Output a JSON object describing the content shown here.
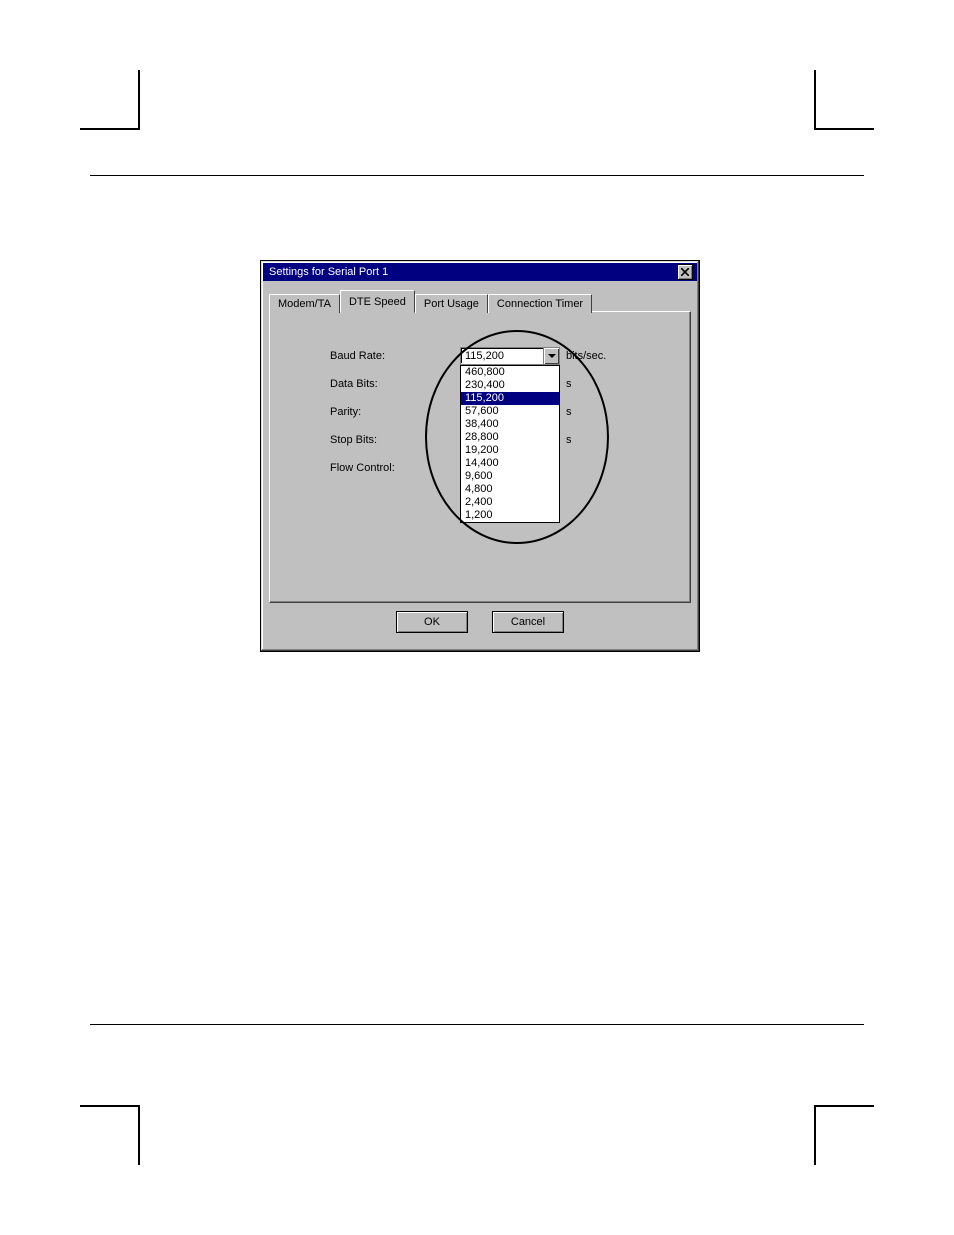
{
  "dialog": {
    "title": "Settings for Serial Port 1",
    "tabs": [
      {
        "label": "Modem/TA"
      },
      {
        "label": "DTE Speed"
      },
      {
        "label": "Port Usage"
      },
      {
        "label": "Connection Timer"
      }
    ],
    "active_tab": "DTE Speed",
    "fields": {
      "baud_rate": {
        "label": "Baud Rate:",
        "value": "115,200",
        "unit": "bits/sec."
      },
      "data_bits": {
        "label": "Data Bits:",
        "unit": "s"
      },
      "parity": {
        "label": "Parity:",
        "unit": "s"
      },
      "stop_bits": {
        "label": "Stop Bits:",
        "unit": "s"
      },
      "flow_ctrl": {
        "label": "Flow Control:"
      }
    },
    "baud_options": [
      "460,800",
      "230,400",
      "115,200",
      "57,600",
      "38,400",
      "28,800",
      "19,200",
      "14,400",
      "9,600",
      "4,800",
      "2,400",
      "1,200"
    ],
    "baud_selected": "115,200",
    "buttons": {
      "ok": "OK",
      "cancel": "Cancel"
    }
  }
}
